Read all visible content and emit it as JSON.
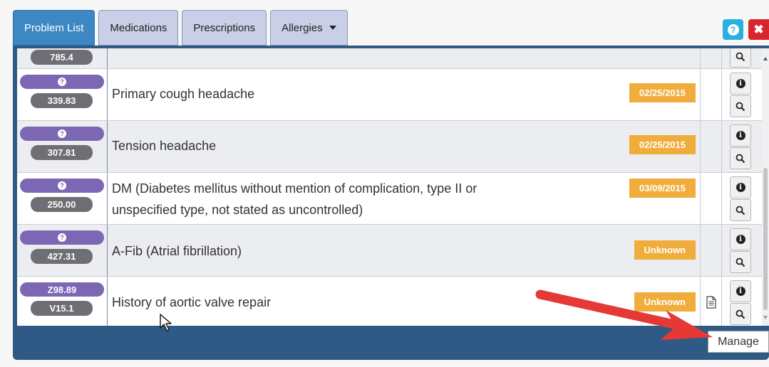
{
  "tabs": [
    {
      "label": "Problem List",
      "active": true
    },
    {
      "label": "Medications",
      "active": false
    },
    {
      "label": "Prescriptions",
      "active": false
    },
    {
      "label": "Allergies",
      "active": false
    }
  ],
  "header_buttons": {
    "help_icon": "question-circle",
    "close_label": "✖"
  },
  "rows": [
    {
      "icd9": "339.83",
      "desc_line1": "Primary cough headache",
      "desc_line2": "",
      "date": "02/25/2015"
    },
    {
      "icd9": "307.81",
      "desc_line1": "Tension headache",
      "desc_line2": "",
      "date": "02/25/2015"
    },
    {
      "icd9": "250.00",
      "desc_line1": "DM (Diabetes mellitus without mention of complication, type II or",
      "desc_line2": "unspecified type, not stated as uncontrolled)",
      "date": "03/09/2015"
    },
    {
      "icd9": "427.31",
      "desc_line1": "A-Fib (Atrial fibrillation)",
      "desc_line2": "",
      "date": "Unknown"
    },
    {
      "icd10": "Z98.89",
      "icd9": "V15.1",
      "desc_line1": "History of aortic valve repair",
      "desc_line2": "",
      "date": "Unknown",
      "has_note": true
    }
  ],
  "partial_row_code": "785.4",
  "tooltip": {
    "label": "Manage"
  },
  "colors": {
    "active_tab": "#3d87c4",
    "panel": "#2f5a86",
    "date_badge": "#f0ad3c",
    "code_pill": "#7b67b3",
    "arrow": "#e53935"
  }
}
